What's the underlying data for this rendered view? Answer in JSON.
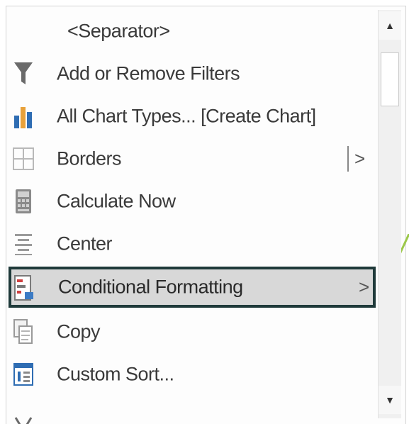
{
  "menu": {
    "items": [
      {
        "label": "<Separator>",
        "icon": "none",
        "has_submenu": false,
        "selected": false
      },
      {
        "label": "Add or Remove Filters",
        "icon": "filter-icon",
        "has_submenu": false,
        "selected": false
      },
      {
        "label": "All Chart Types... [Create Chart]",
        "icon": "bar-chart-icon",
        "has_submenu": false,
        "selected": false
      },
      {
        "label": "Borders",
        "icon": "borders-icon",
        "has_submenu": true,
        "submenu_arrow": ">",
        "selected": false
      },
      {
        "label": "Calculate Now",
        "icon": "calculator-icon",
        "has_submenu": false,
        "selected": false
      },
      {
        "label": "Center",
        "icon": "align-center-icon",
        "has_submenu": false,
        "selected": false
      },
      {
        "label": "Conditional Formatting",
        "icon": "conditional-formatting-icon",
        "has_submenu": true,
        "submenu_arrow": ">",
        "selected": true
      },
      {
        "label": "Copy",
        "icon": "copy-icon",
        "has_submenu": false,
        "selected": false
      },
      {
        "label": "Custom Sort...",
        "icon": "custom-sort-icon",
        "has_submenu": false,
        "selected": false
      },
      {
        "label": "",
        "icon": "cut-icon",
        "has_submenu": false,
        "selected": false
      }
    ]
  },
  "scrollbar": {
    "up_arrow": "▲",
    "down_arrow": "▼"
  },
  "colors": {
    "selection_background": "#d8d8d8",
    "selection_border": "#1f3a3a",
    "connector_line": "#9cc84a",
    "chart_icon_orange": "#e8a13a",
    "chart_icon_blue": "#2f6db3"
  }
}
